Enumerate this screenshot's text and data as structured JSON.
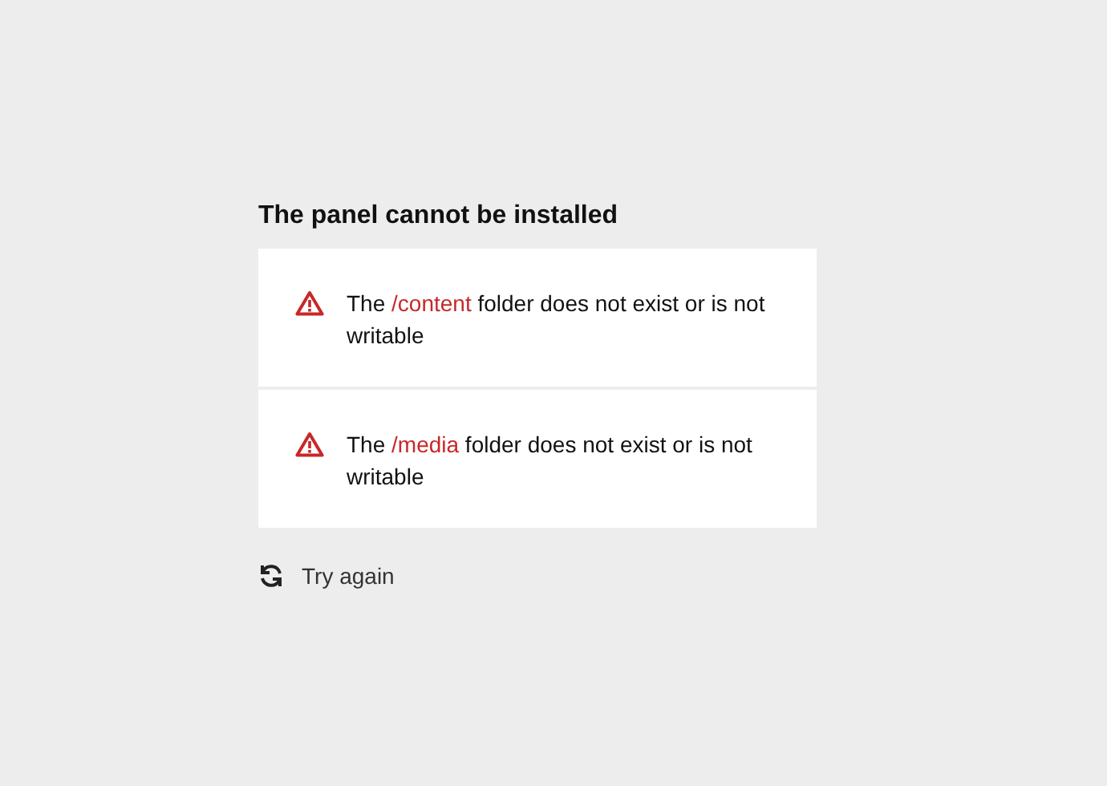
{
  "title": "The panel cannot be installed",
  "errors": [
    {
      "before": "The ",
      "folder": "/content",
      "after": " folder does not exist or is not writable"
    },
    {
      "before": "The ",
      "folder": "/media",
      "after": " folder does not exist or is not writable"
    }
  ],
  "retry_button": "Try again"
}
